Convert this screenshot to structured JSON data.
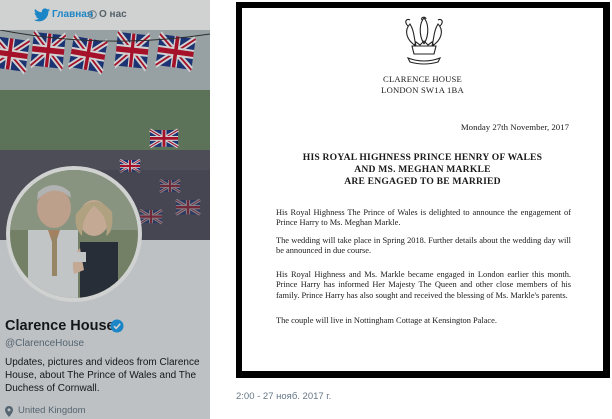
{
  "nav": {
    "home_label": "Главная",
    "about_label": "О нас"
  },
  "profile": {
    "name": "Clarence House",
    "handle": "@ClarenceHouse",
    "bio": "Updates, pictures and videos from Clarence House, about The Prince of Wales and The Duchess of Cornwall.",
    "location": "United Kingdom"
  },
  "letter": {
    "header_line1": "CLARENCE HOUSE",
    "header_line2": "LONDON SW1A 1BA",
    "date": "Monday 27th November, 2017",
    "title_line1": "HIS ROYAL HIGHNESS PRINCE HENRY OF WALES",
    "title_line2": "AND MS. MEGHAN MARKLE",
    "title_line3": "ARE ENGAGED TO BE MARRIED",
    "paragraph1": "His Royal Highness The Prince of Wales is delighted to announce the engagement of Prince Harry to Ms. Meghan Markle.",
    "paragraph2": "The wedding will take place in Spring 2018. Further details about the wedding day will be announced in due course.",
    "paragraph3": "His Royal Highness and Ms. Markle became engaged in London earlier this month. Prince Harry has informed Her Majesty The Queen and other close members of his family. Prince Harry has also sought and received the blessing of Ms. Markle's parents.",
    "paragraph4": "The couple will live in Nottingham Cottage at Kensington Palace."
  },
  "tweet": {
    "timestamp": "2:00 - 27 нояб. 2017 г."
  },
  "colors": {
    "accent": "#1da1f2",
    "verified": "#1da1f2",
    "muted_text": "#657786"
  },
  "icons": [
    "twitter-bird-icon",
    "info-icon",
    "verified-badge-icon",
    "location-pin-icon",
    "prince-of-wales-feathers-emblem"
  ]
}
